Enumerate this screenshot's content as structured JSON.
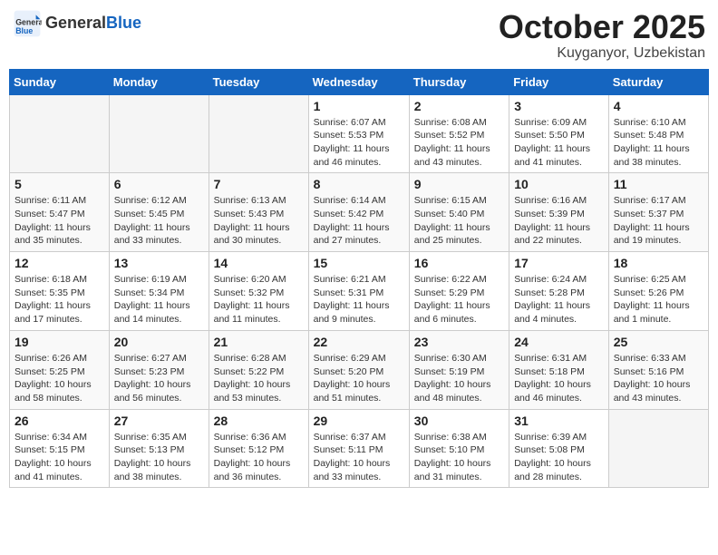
{
  "header": {
    "logo_general": "General",
    "logo_blue": "Blue",
    "month_title": "October 2025",
    "location": "Kuyganyor, Uzbekistan"
  },
  "weekdays": [
    "Sunday",
    "Monday",
    "Tuesday",
    "Wednesday",
    "Thursday",
    "Friday",
    "Saturday"
  ],
  "weeks": [
    [
      {
        "day": "",
        "info": ""
      },
      {
        "day": "",
        "info": ""
      },
      {
        "day": "",
        "info": ""
      },
      {
        "day": "1",
        "info": "Sunrise: 6:07 AM\nSunset: 5:53 PM\nDaylight: 11 hours and 46 minutes."
      },
      {
        "day": "2",
        "info": "Sunrise: 6:08 AM\nSunset: 5:52 PM\nDaylight: 11 hours and 43 minutes."
      },
      {
        "day": "3",
        "info": "Sunrise: 6:09 AM\nSunset: 5:50 PM\nDaylight: 11 hours and 41 minutes."
      },
      {
        "day": "4",
        "info": "Sunrise: 6:10 AM\nSunset: 5:48 PM\nDaylight: 11 hours and 38 minutes."
      }
    ],
    [
      {
        "day": "5",
        "info": "Sunrise: 6:11 AM\nSunset: 5:47 PM\nDaylight: 11 hours and 35 minutes."
      },
      {
        "day": "6",
        "info": "Sunrise: 6:12 AM\nSunset: 5:45 PM\nDaylight: 11 hours and 33 minutes."
      },
      {
        "day": "7",
        "info": "Sunrise: 6:13 AM\nSunset: 5:43 PM\nDaylight: 11 hours and 30 minutes."
      },
      {
        "day": "8",
        "info": "Sunrise: 6:14 AM\nSunset: 5:42 PM\nDaylight: 11 hours and 27 minutes."
      },
      {
        "day": "9",
        "info": "Sunrise: 6:15 AM\nSunset: 5:40 PM\nDaylight: 11 hours and 25 minutes."
      },
      {
        "day": "10",
        "info": "Sunrise: 6:16 AM\nSunset: 5:39 PM\nDaylight: 11 hours and 22 minutes."
      },
      {
        "day": "11",
        "info": "Sunrise: 6:17 AM\nSunset: 5:37 PM\nDaylight: 11 hours and 19 minutes."
      }
    ],
    [
      {
        "day": "12",
        "info": "Sunrise: 6:18 AM\nSunset: 5:35 PM\nDaylight: 11 hours and 17 minutes."
      },
      {
        "day": "13",
        "info": "Sunrise: 6:19 AM\nSunset: 5:34 PM\nDaylight: 11 hours and 14 minutes."
      },
      {
        "day": "14",
        "info": "Sunrise: 6:20 AM\nSunset: 5:32 PM\nDaylight: 11 hours and 11 minutes."
      },
      {
        "day": "15",
        "info": "Sunrise: 6:21 AM\nSunset: 5:31 PM\nDaylight: 11 hours and 9 minutes."
      },
      {
        "day": "16",
        "info": "Sunrise: 6:22 AM\nSunset: 5:29 PM\nDaylight: 11 hours and 6 minutes."
      },
      {
        "day": "17",
        "info": "Sunrise: 6:24 AM\nSunset: 5:28 PM\nDaylight: 11 hours and 4 minutes."
      },
      {
        "day": "18",
        "info": "Sunrise: 6:25 AM\nSunset: 5:26 PM\nDaylight: 11 hours and 1 minute."
      }
    ],
    [
      {
        "day": "19",
        "info": "Sunrise: 6:26 AM\nSunset: 5:25 PM\nDaylight: 10 hours and 58 minutes."
      },
      {
        "day": "20",
        "info": "Sunrise: 6:27 AM\nSunset: 5:23 PM\nDaylight: 10 hours and 56 minutes."
      },
      {
        "day": "21",
        "info": "Sunrise: 6:28 AM\nSunset: 5:22 PM\nDaylight: 10 hours and 53 minutes."
      },
      {
        "day": "22",
        "info": "Sunrise: 6:29 AM\nSunset: 5:20 PM\nDaylight: 10 hours and 51 minutes."
      },
      {
        "day": "23",
        "info": "Sunrise: 6:30 AM\nSunset: 5:19 PM\nDaylight: 10 hours and 48 minutes."
      },
      {
        "day": "24",
        "info": "Sunrise: 6:31 AM\nSunset: 5:18 PM\nDaylight: 10 hours and 46 minutes."
      },
      {
        "day": "25",
        "info": "Sunrise: 6:33 AM\nSunset: 5:16 PM\nDaylight: 10 hours and 43 minutes."
      }
    ],
    [
      {
        "day": "26",
        "info": "Sunrise: 6:34 AM\nSunset: 5:15 PM\nDaylight: 10 hours and 41 minutes."
      },
      {
        "day": "27",
        "info": "Sunrise: 6:35 AM\nSunset: 5:13 PM\nDaylight: 10 hours and 38 minutes."
      },
      {
        "day": "28",
        "info": "Sunrise: 6:36 AM\nSunset: 5:12 PM\nDaylight: 10 hours and 36 minutes."
      },
      {
        "day": "29",
        "info": "Sunrise: 6:37 AM\nSunset: 5:11 PM\nDaylight: 10 hours and 33 minutes."
      },
      {
        "day": "30",
        "info": "Sunrise: 6:38 AM\nSunset: 5:10 PM\nDaylight: 10 hours and 31 minutes."
      },
      {
        "day": "31",
        "info": "Sunrise: 6:39 AM\nSunset: 5:08 PM\nDaylight: 10 hours and 28 minutes."
      },
      {
        "day": "",
        "info": ""
      }
    ]
  ]
}
